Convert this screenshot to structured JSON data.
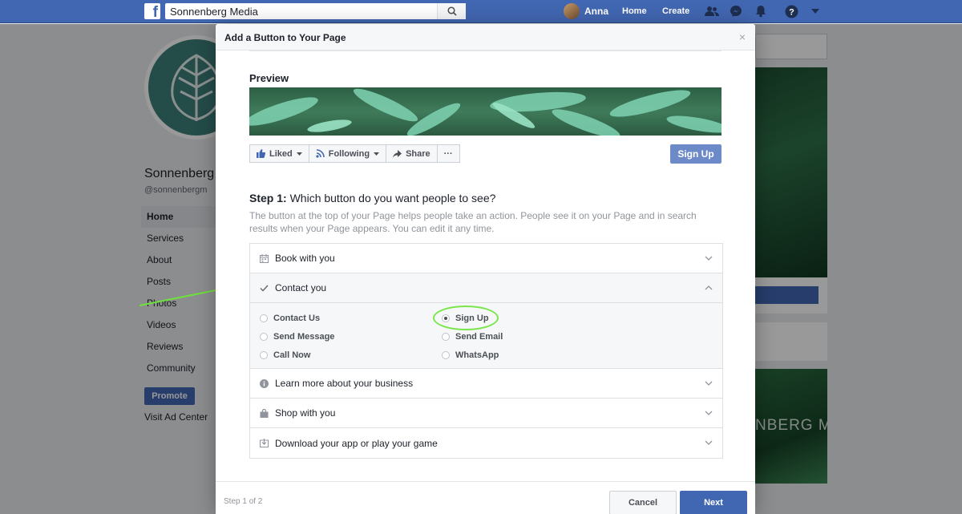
{
  "topbar": {
    "logo": "f",
    "search_value": "Sonnenberg Media",
    "user_name": "Anna",
    "home": "Home",
    "create": "Create",
    "icons": [
      "friends-icon",
      "messenger-icon",
      "notifications-icon",
      "help-icon",
      "account-menu-icon"
    ]
  },
  "background_page": {
    "page_name": "Sonnenberg",
    "handle": "@sonnenbergm",
    "nav": [
      "Home",
      "Services",
      "About",
      "Posts",
      "Photos",
      "Videos",
      "Reviews",
      "Community"
    ],
    "promote": "Promote",
    "visit_ad_center": "Visit Ad Center",
    "cover_text": "NBERG MEDIA"
  },
  "dialog": {
    "title": "Add a Button to Your Page",
    "close": "×",
    "preview_label": "Preview",
    "preview_actions": {
      "liked": "Liked",
      "following": "Following",
      "share": "Share",
      "more": "···",
      "signup": "Sign Up"
    },
    "step_label": "Step 1:",
    "step_question": " Which button do you want people to see?",
    "step_description": "The button at the top of your Page helps people take an action. People see it on your Page and in search results when your Page appears. You can edit it any time.",
    "categories": [
      {
        "label": "Book with you",
        "icon": "calendar-icon"
      },
      {
        "label": "Contact you",
        "icon": "checkmark-icon"
      },
      {
        "label": "Learn more about your business",
        "icon": "info-icon"
      },
      {
        "label": "Shop with you",
        "icon": "shopping-bag-icon"
      },
      {
        "label": "Download your app or play your game",
        "icon": "download-icon"
      }
    ],
    "contact_options": {
      "col1": [
        "Contact Us",
        "Send Message",
        "Call Now"
      ],
      "col2": [
        "Sign Up",
        "Send Email",
        "WhatsApp"
      ],
      "selected": "Sign Up"
    },
    "footer": {
      "step_count": "Step 1 of 2",
      "cancel": "Cancel",
      "next": "Next"
    }
  },
  "colors": {
    "brand_blue": "#4267b2",
    "highlight_green": "#79e64a",
    "annotation_arrow": "#6fe03c"
  }
}
